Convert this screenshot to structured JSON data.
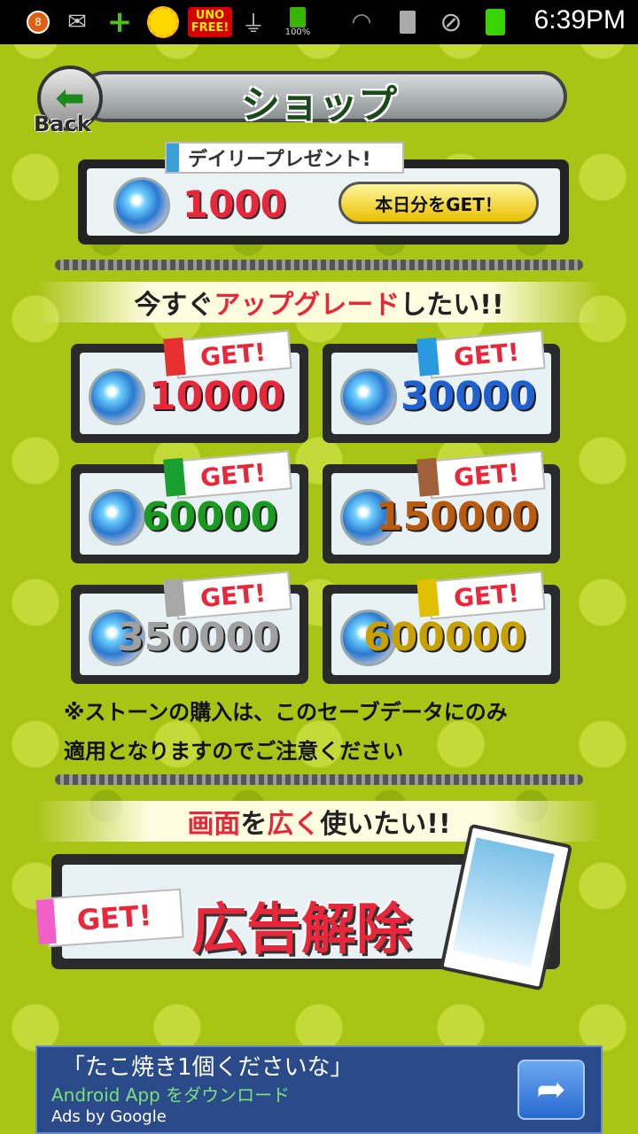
{
  "status_bar": {
    "notification_count": "8",
    "uno_label": "UNO FREE!",
    "battery_text": "100%",
    "time": "6:39PM"
  },
  "header": {
    "title": "ショップ",
    "back_label": "Back"
  },
  "daily": {
    "tag": "デイリープレゼント!",
    "value": "1000",
    "button_label": "本日分をGET！"
  },
  "upgrade_banner": {
    "prefix": "今すぐ",
    "highlight": "アップグレード",
    "suffix": "したい!!"
  },
  "packs": [
    {
      "get_label": "GET!",
      "value": "10000",
      "color": "#e8283a",
      "flag_color": "#e83030"
    },
    {
      "get_label": "GET!",
      "value": "30000",
      "color": "#2060d0",
      "flag_color": "#2a9ae0"
    },
    {
      "get_label": "GET!",
      "value": "60000",
      "color": "#1a9a20",
      "flag_color": "#1aa030"
    },
    {
      "get_label": "GET!",
      "value": "150000",
      "color": "#b85a10",
      "flag_color": "#a0603a"
    },
    {
      "get_label": "GET!",
      "value": "350000",
      "color": "#a0a0a0",
      "flag_color": "#a8a8a8"
    },
    {
      "get_label": "GET!",
      "value": "600000",
      "color": "#c8a000",
      "flag_color": "#e0c000"
    }
  ],
  "notice": {
    "line1": "※ストーンの購入は、このセーブデータにのみ",
    "line2": "適用となりますのでご注意ください"
  },
  "wide_banner": {
    "part1": "画面",
    "part2": "を",
    "part3": "広く",
    "part4": "使いたい!!"
  },
  "ad_removal": {
    "get_label": "GET!",
    "title": "広告解除"
  },
  "ad_banner": {
    "headline": "「たこ焼き1個くださいな」",
    "subtitle": "Android App をダウンロード",
    "byline": "Ads by Google"
  }
}
